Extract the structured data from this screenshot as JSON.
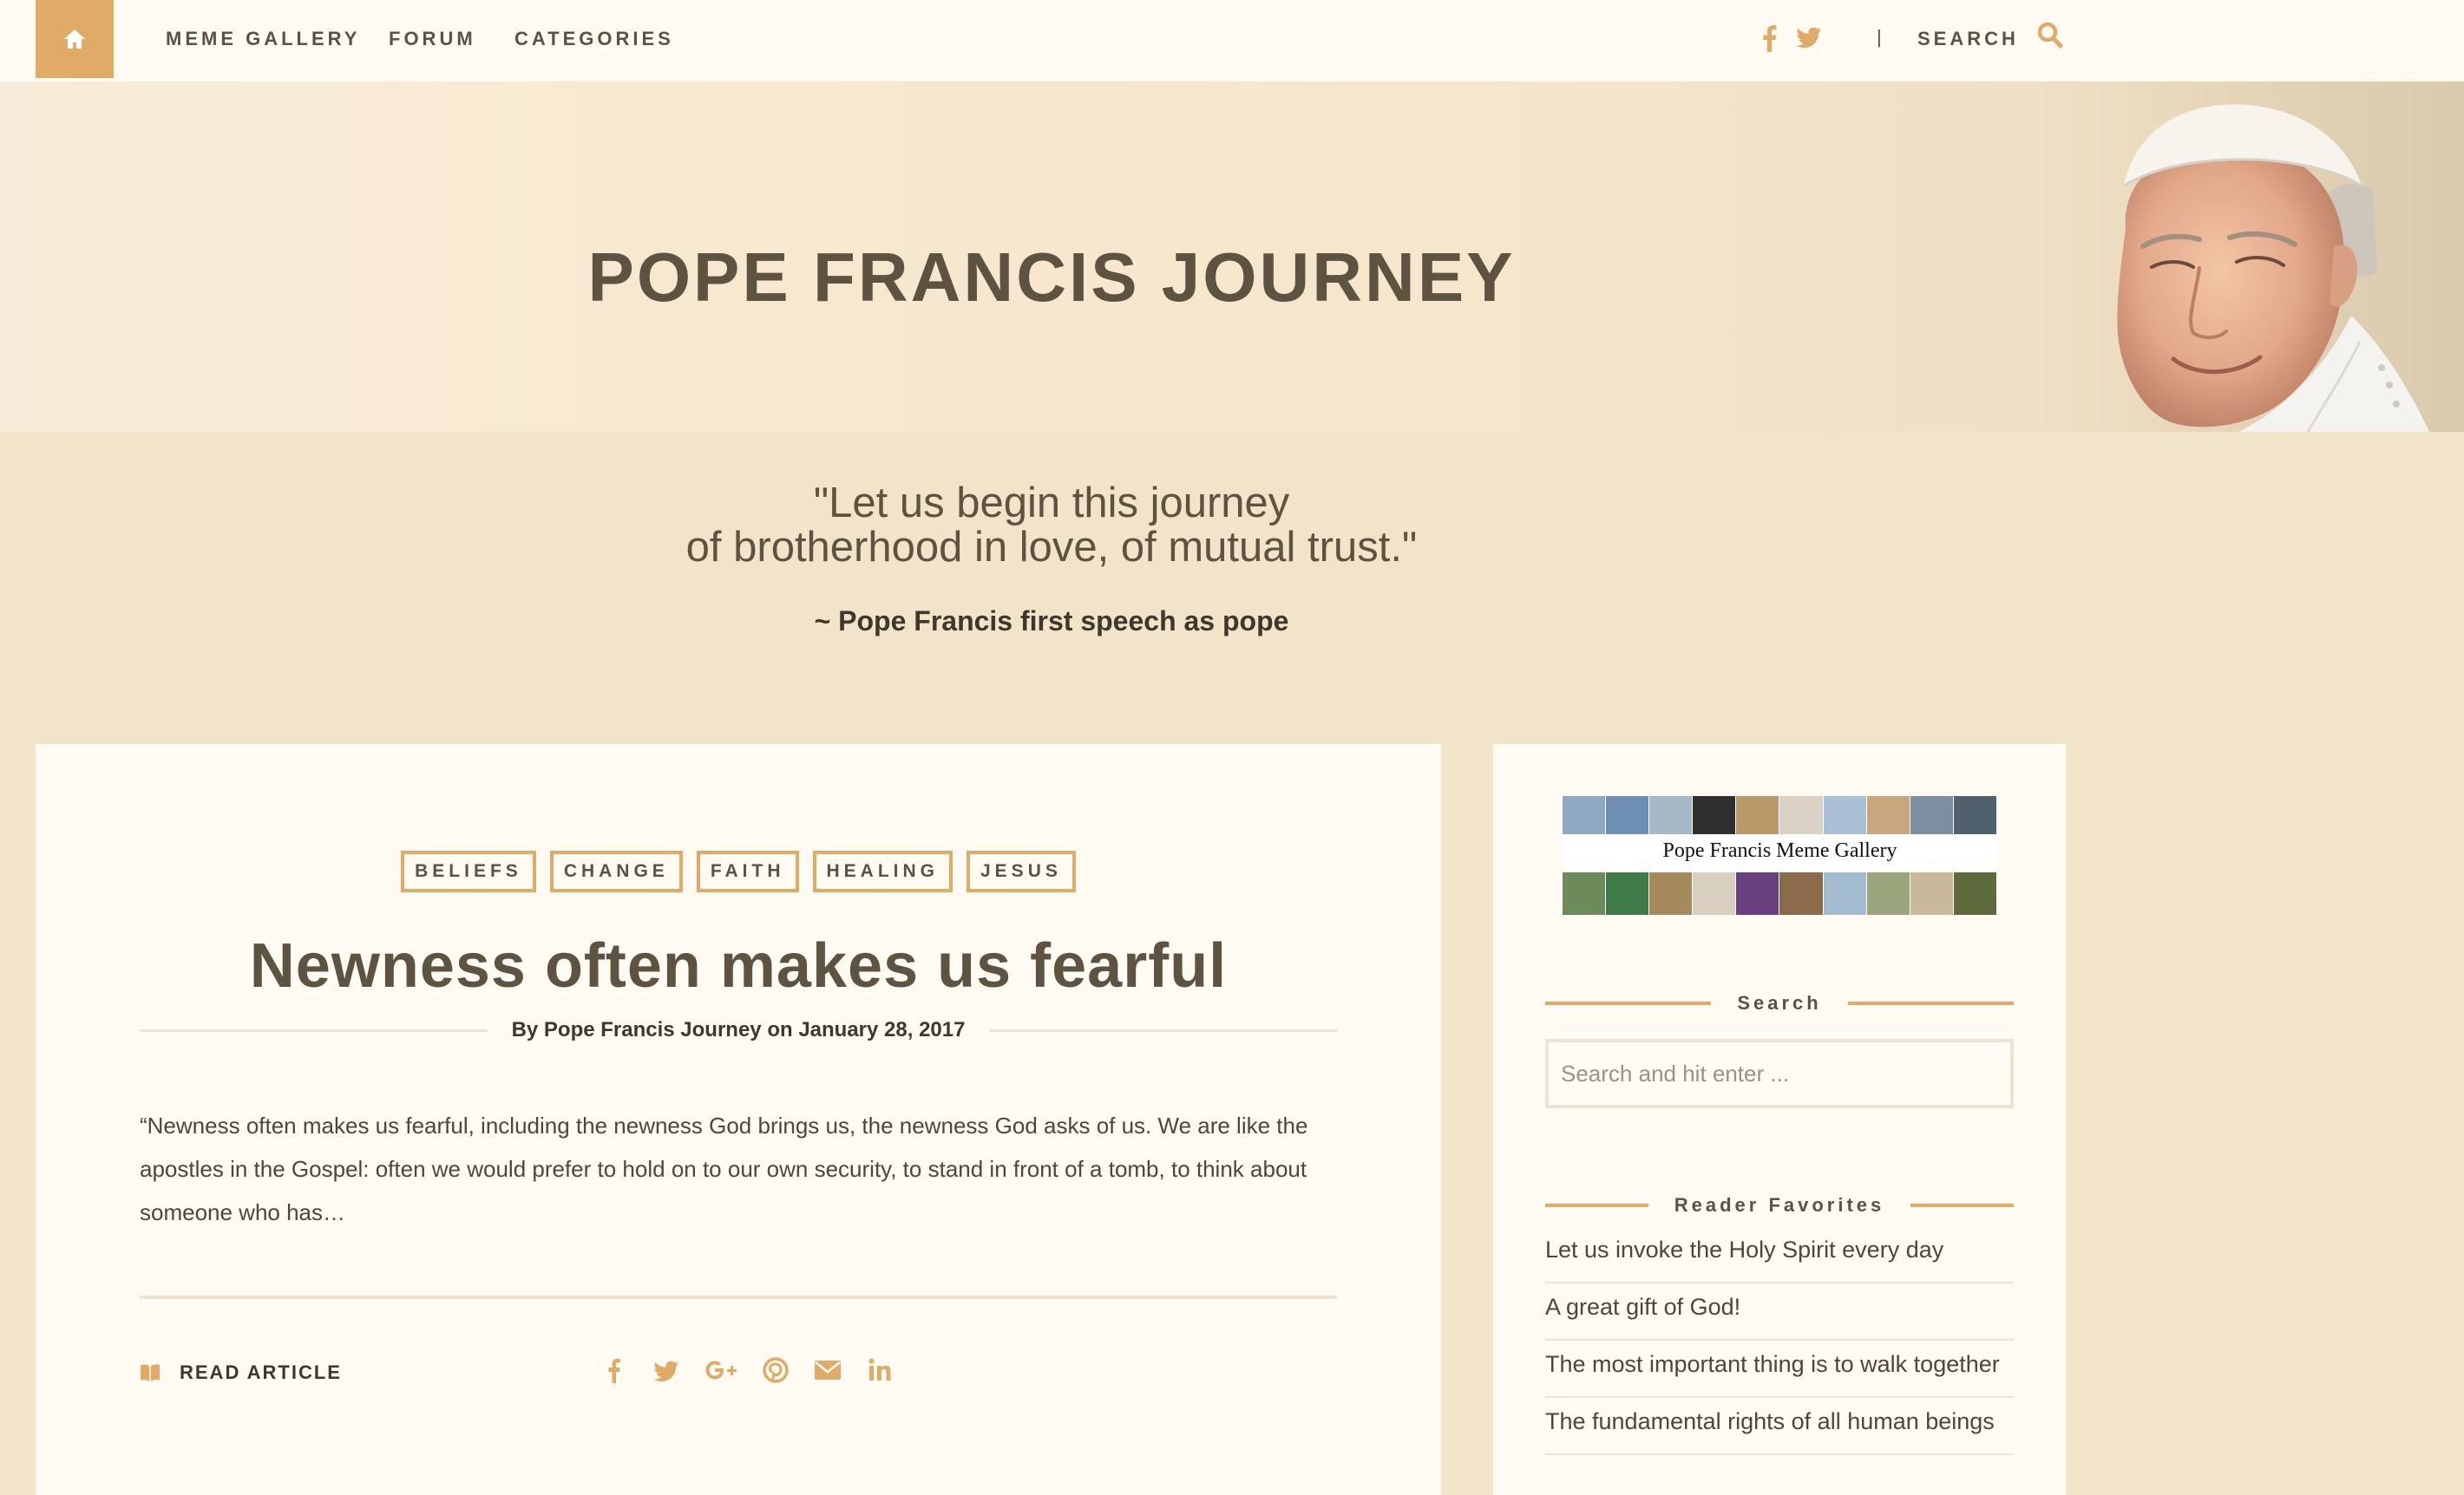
{
  "nav": {
    "links": [
      "MEME GALLERY",
      "FORUM",
      "CATEGORIES"
    ],
    "search_label": "SEARCH",
    "divider": "|"
  },
  "hero": {
    "title": "POPE FRANCIS JOURNEY"
  },
  "quote": {
    "line1": "\"Let us begin this journey",
    "line2": "of brotherhood in love, of mutual trust.\"",
    "attribution": "~ Pope Francis first speech as pope"
  },
  "article": {
    "tags": [
      "BELIEFS",
      "CHANGE",
      "FAITH",
      "HEALING",
      "JESUS"
    ],
    "title": "Newness often makes us fearful",
    "byline": "By Pope Francis Journey on January 28, 2017",
    "excerpt": "“Newness often makes us fearful, including the newness God brings us, the newness God asks of us. We are like the apostles in the Gospel: often we would prefer to hold on to our own security, to stand in front of a tomb, to think about someone who has…",
    "read_label": "READ ARTICLE",
    "share_icons": [
      "facebook-icon",
      "twitter-icon",
      "google-plus-icon",
      "pinterest-icon",
      "email-icon",
      "linkedin-icon"
    ]
  },
  "sidebar": {
    "gallery_label": "Pope Francis Meme Gallery",
    "search_heading": "Search",
    "search_placeholder": "Search and hit enter ...",
    "favorites_heading": "Reader Favorites",
    "favorites": [
      "Let us invoke the Holy Spirit every day",
      "A great gift of God!",
      "The most important thing is to walk together",
      "The fundamental rights of all human beings"
    ]
  },
  "colors": {
    "accent": "#e0ab66",
    "background": "#f2e4c9",
    "card": "#fffaf2",
    "text": "#5e5241"
  }
}
